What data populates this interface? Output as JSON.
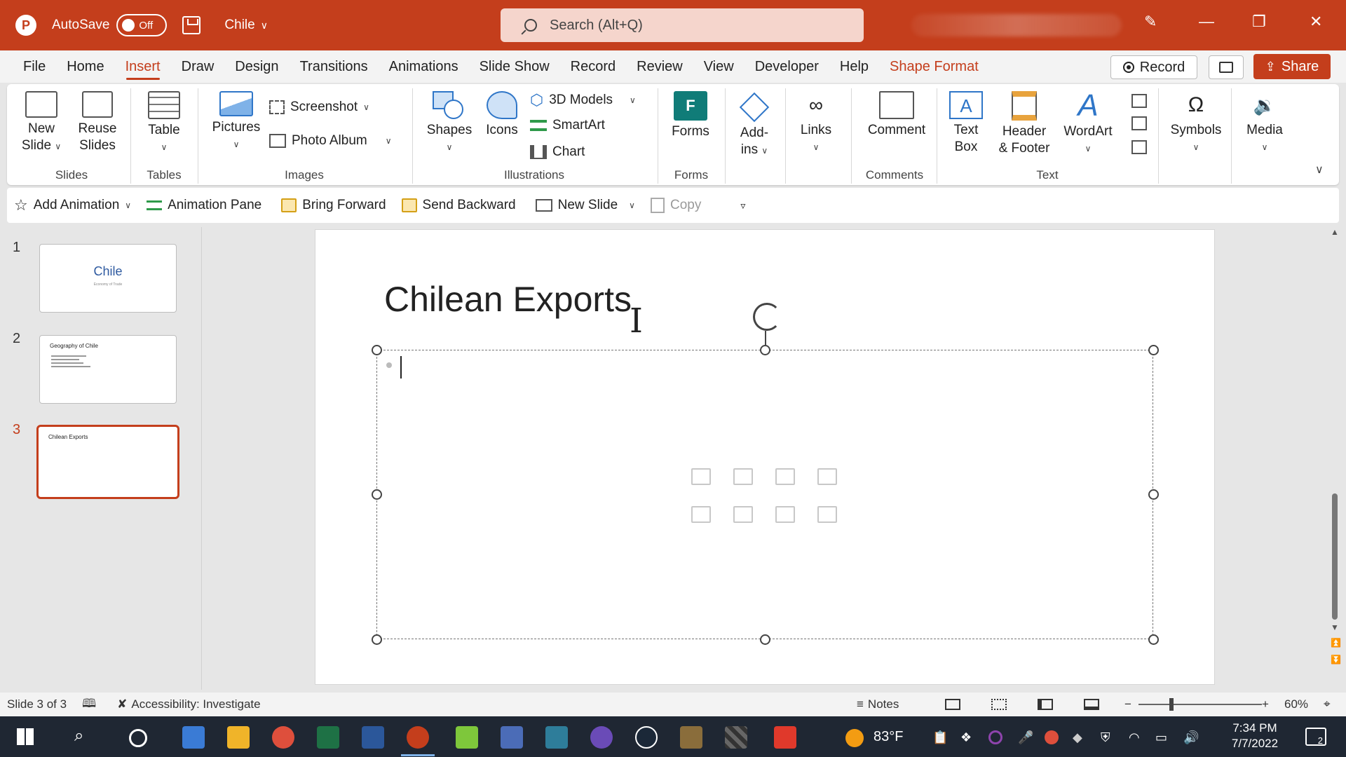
{
  "titlebar": {
    "app_letter": "P",
    "autosave_label": "AutoSave",
    "autosave_state": "Off",
    "doc_name": "Chile",
    "search_placeholder": "Search (Alt+Q)",
    "accent": "#c43e1c"
  },
  "menu": {
    "tabs": [
      "File",
      "Home",
      "Insert",
      "Draw",
      "Design",
      "Transitions",
      "Animations",
      "Slide Show",
      "Record",
      "Review",
      "View",
      "Developer",
      "Help",
      "Shape Format"
    ],
    "active": "Insert",
    "record_label": "Record",
    "share_label": "Share"
  },
  "ribbon": {
    "new_slide_1": "New",
    "new_slide_2": "Slide",
    "reuse_slides_1": "Reuse",
    "reuse_slides_2": "Slides",
    "slides_group": "Slides",
    "table": "Table",
    "tables_group": "Tables",
    "pictures": "Pictures",
    "screenshot": "Screenshot",
    "photo_album": "Photo Album",
    "images_group": "Images",
    "shapes": "Shapes",
    "icons": "Icons",
    "models_3d": "3D Models",
    "smartart": "SmartArt",
    "chart": "Chart",
    "illustrations_group": "Illustrations",
    "forms": "Forms",
    "forms_group": "Forms",
    "addins_1": "Add-",
    "addins_2": "ins",
    "links": "Links",
    "comment": "Comment",
    "comments_group": "Comments",
    "textbox_1": "Text",
    "textbox_2": "Box",
    "header_footer_1": "Header",
    "header_footer_2": "& Footer",
    "wordart": "WordArt",
    "text_group": "Text",
    "symbols": "Symbols",
    "media": "Media"
  },
  "qat": {
    "add_animation": "Add Animation",
    "animation_pane": "Animation Pane",
    "bring_forward": "Bring Forward",
    "send_backward": "Send Backward",
    "new_slide": "New Slide",
    "copy": "Copy"
  },
  "thumbnails": [
    {
      "num": "1",
      "title": "Chile",
      "subtitle": "Economy of Trade"
    },
    {
      "num": "2",
      "title": "Geography of Chile"
    },
    {
      "num": "3",
      "title": "Chilean Exports"
    }
  ],
  "slide": {
    "title": "Chilean Exports"
  },
  "status": {
    "slide_counter": "Slide 3 of 3",
    "accessibility": "Accessibility: Investigate",
    "notes": "Notes",
    "zoom": "60%"
  },
  "taskbar": {
    "weather": "83°F",
    "time": "7:34 PM",
    "date": "7/7/2022",
    "notification_count": "2"
  }
}
